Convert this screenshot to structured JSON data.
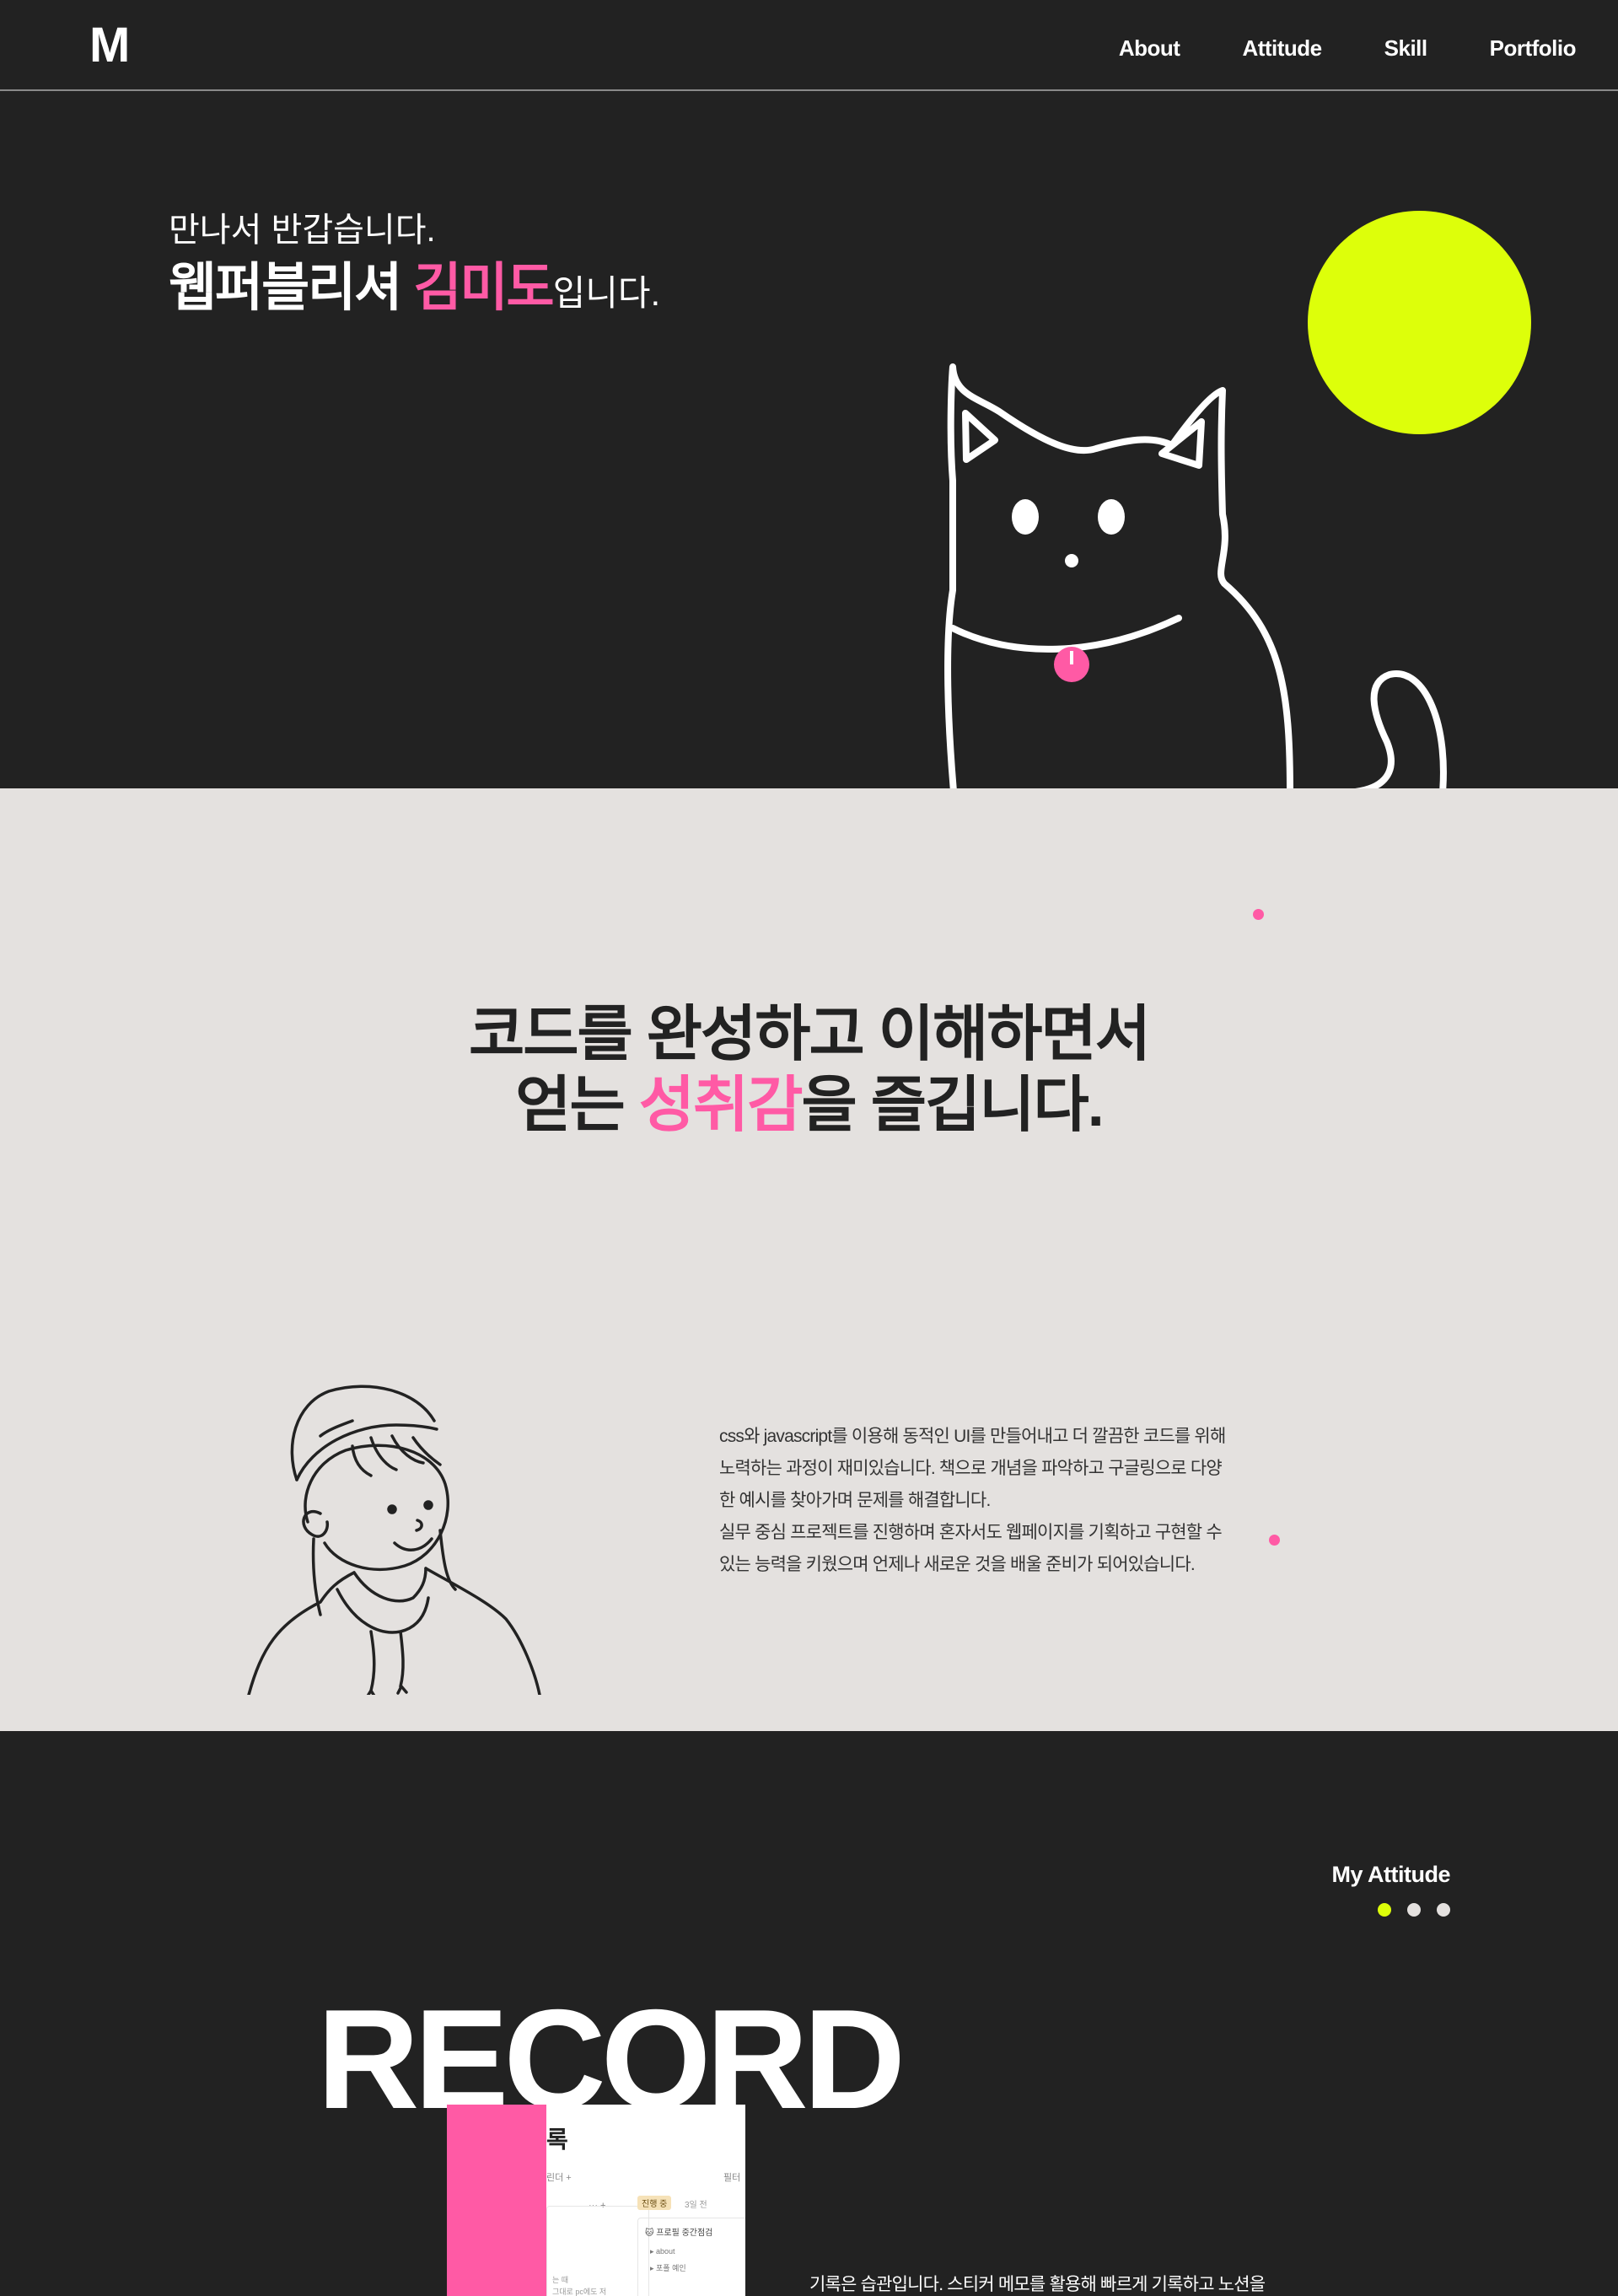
{
  "nav": {
    "logo": "M",
    "links": [
      "About",
      "Attitude",
      "Skill",
      "Portfolio"
    ]
  },
  "hero": {
    "greeting": "만나서 반갑습니다.",
    "title_prefix": "웹퍼블리셔 ",
    "name": "김미도",
    "title_suffix": "입니다."
  },
  "intro": {
    "line1": "코드를 완성하고 이해하면서",
    "line2_prefix": "얻는 ",
    "line2_highlight": "성취감",
    "line2_suffix": "을 즐깁니다.",
    "paragraph1": "css와 javascript를 이용해 동적인 UI를 만들어내고 더 깔끔한 코드를 위해 노력하는 과정이 재미있습니다. 책으로 개념을 파악하고 구글링으로 다양한 예시를 찾아가며 문제를 해결합니다.",
    "paragraph2": "실무 중심 프로젝트를 진행하며 혼자서도 웹페이지를 기획하고 구현할 수 있는 능력을 키웠으며 언제나 새로운 것을 배울 준비가 되어있습니다."
  },
  "attitude": {
    "label": "My Attitude",
    "big_word": "RECORD",
    "screenshot": {
      "title": "록",
      "sub_left": "린더  +",
      "sub_right": "필터",
      "dots": "···  +",
      "badge": "진행 중",
      "badge_time": "3일 전",
      "card_title": "🐱 프로필 중간점검",
      "items": [
        "▸  about",
        "▸  포폴 예인"
      ],
      "left_text_1": "는 때",
      "left_text_2": "그대로 pc에도 저"
    },
    "description": "기록은 습관입니다. 스티커 메모를 활용해 빠르게 기록하고 노션을"
  },
  "colors": {
    "background_dark": "#222222",
    "background_light": "#e4e1df",
    "accent_pink": "#ff5aa5",
    "accent_lime": "#ddff0a"
  },
  "icons": [
    "cat-illustration",
    "person-illustration",
    "sun-circle"
  ]
}
